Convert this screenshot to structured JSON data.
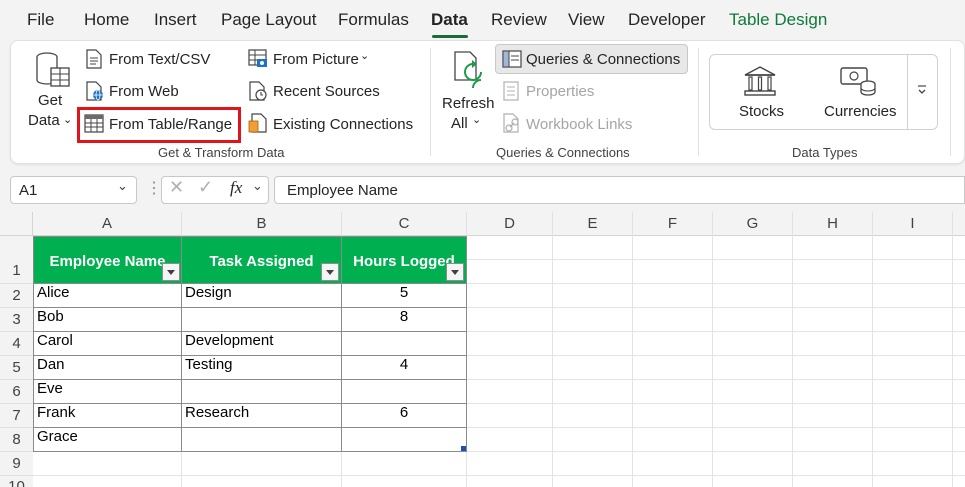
{
  "menu": {
    "tabs": [
      "File",
      "Home",
      "Insert",
      "Page Layout",
      "Formulas",
      "Data",
      "Review",
      "View",
      "Developer",
      "Table Design"
    ],
    "active": "Data"
  },
  "ribbon": {
    "get_transform": {
      "get_data_line1": "Get",
      "get_data_line2": "Data",
      "from_text_csv": "From Text/CSV",
      "from_web": "From Web",
      "from_table_range": "From Table/Range",
      "from_picture": "From Picture",
      "recent_sources": "Recent Sources",
      "existing_connections": "Existing Connections",
      "label": "Get & Transform Data"
    },
    "queries": {
      "refresh_line1": "Refresh",
      "refresh_line2": "All",
      "queries_connections": "Queries & Connections",
      "properties": "Properties",
      "workbook_links": "Workbook Links",
      "label": "Queries & Connections"
    },
    "data_types": {
      "stocks": "Stocks",
      "currencies": "Currencies",
      "label": "Data Types"
    }
  },
  "formula_bar": {
    "name_box": "A1",
    "fx": "fx",
    "formula": "Employee Name"
  },
  "sheet": {
    "columns": [
      "A",
      "B",
      "C",
      "D",
      "E",
      "F",
      "G",
      "H",
      "I"
    ],
    "rows": [
      "1",
      "2",
      "3",
      "4",
      "5",
      "6",
      "7",
      "8",
      "9",
      "10"
    ],
    "table": {
      "headers": [
        "Employee Name",
        "Task Assigned",
        "Hours Logged"
      ],
      "data": [
        [
          "Alice",
          "Design",
          "5"
        ],
        [
          "Bob",
          "",
          "8"
        ],
        [
          "Carol",
          "Development",
          ""
        ],
        [
          "Dan",
          "Testing",
          "4"
        ],
        [
          "Eve",
          "",
          ""
        ],
        [
          "Frank",
          "Research",
          "6"
        ],
        [
          "Grace",
          "",
          ""
        ]
      ]
    }
  },
  "colors": {
    "table_header": "#00b050",
    "highlight": "#e0141b",
    "active_tab": "#1e6b3a",
    "table_design_tab": "#0e7a3c"
  }
}
